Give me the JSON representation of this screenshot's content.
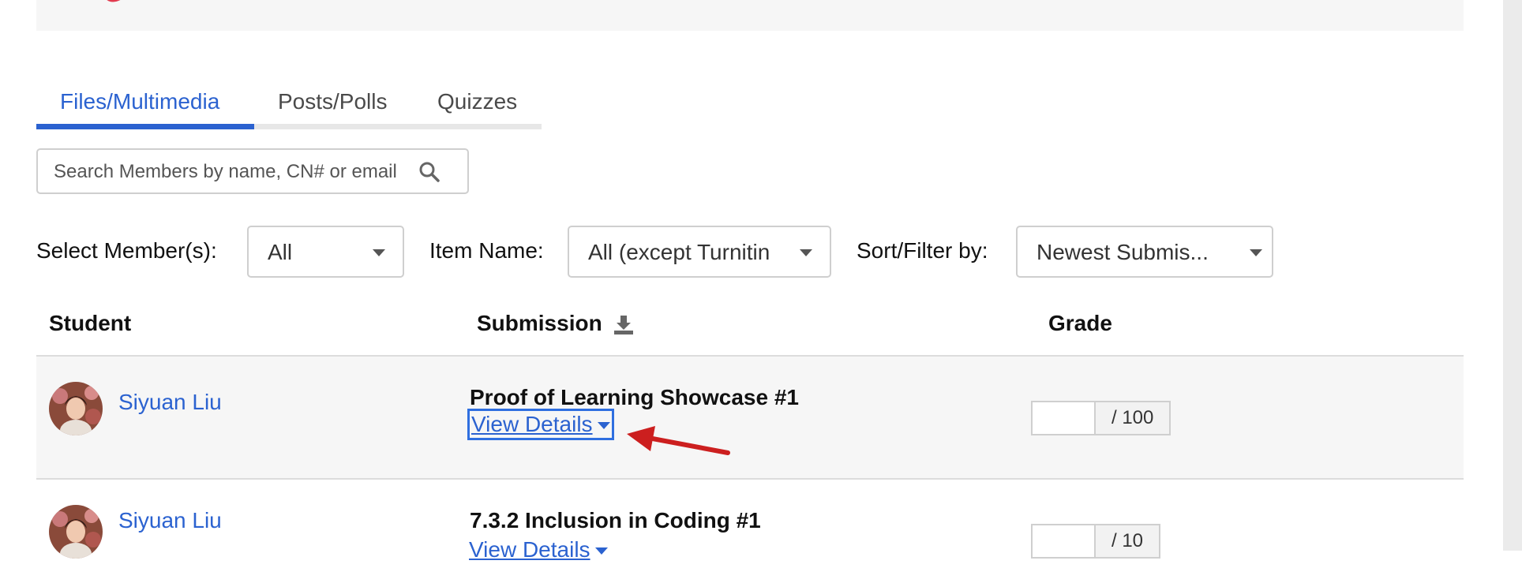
{
  "tabs": [
    {
      "label": "Files/Multimedia",
      "active": true
    },
    {
      "label": "Posts/Polls",
      "active": false
    },
    {
      "label": "Quizzes",
      "active": false
    }
  ],
  "search": {
    "placeholder": "Search Members by name, CN# or email",
    "value": ""
  },
  "filters": {
    "member_label": "Select Member(s):",
    "member_value": "All",
    "item_label": "Item Name:",
    "item_value": "All (except Turnitin",
    "sort_label": "Sort/Filter by:",
    "sort_value": "Newest Submis..."
  },
  "table": {
    "headers": {
      "student": "Student",
      "submission": "Submission",
      "grade": "Grade"
    },
    "rows": [
      {
        "student": "Siyuan Liu",
        "submission": "Proof of Learning Showcase #1",
        "view_details": "View Details",
        "grade_value": "",
        "grade_max": "/ 100"
      },
      {
        "student": "Siyuan Liu",
        "submission": "7.3.2 Inclusion in Coding #1",
        "view_details": "View Details",
        "grade_value": "",
        "grade_max": "/ 10"
      }
    ]
  },
  "colors": {
    "accent": "#2b62d0",
    "annotation": "#cc1f1f"
  },
  "icons": {
    "search": "search-icon",
    "download": "download-icon",
    "dropdown": "caret-down-icon"
  }
}
